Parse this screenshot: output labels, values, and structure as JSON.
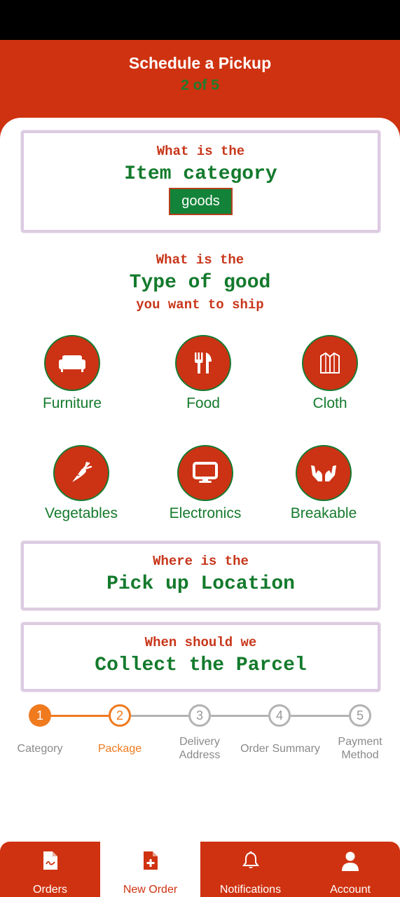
{
  "header": {
    "title": "Schedule a Pickup",
    "step": "2 of 5"
  },
  "category_card": {
    "question": "What is the",
    "heading": "Item category",
    "selected": "goods"
  },
  "good_type": {
    "line1": "What is the",
    "heading": "Type of good",
    "line3": "you want to ship"
  },
  "goods": [
    {
      "label": "Furniture",
      "icon": "sofa-icon"
    },
    {
      "label": "Food",
      "icon": "utensils-icon"
    },
    {
      "label": "Cloth",
      "icon": "shirt-icon"
    },
    {
      "label": "Vegetables",
      "icon": "carrot-icon"
    },
    {
      "label": "Electronics",
      "icon": "monitor-icon"
    },
    {
      "label": "Breakable",
      "icon": "hands-icon"
    }
  ],
  "pickup_card": {
    "question": "Where is the",
    "heading": "Pick up Location"
  },
  "collect_card": {
    "question": "When should we",
    "heading": "Collect the Parcel"
  },
  "stepper": {
    "current": 2,
    "steps": [
      {
        "number": "1",
        "label": "Category",
        "state": "done"
      },
      {
        "number": "2",
        "label": "Package",
        "state": "active"
      },
      {
        "number": "3",
        "label": "Delivery Address",
        "state": "pending"
      },
      {
        "number": "4",
        "label": "Order Summary",
        "state": "pending"
      },
      {
        "number": "5",
        "label": "Payment Method",
        "state": "pending"
      }
    ]
  },
  "bottom_nav": {
    "items": [
      {
        "label": "Orders",
        "icon": "document-icon"
      },
      {
        "label": "New Order",
        "icon": "add-file-icon",
        "active": true
      },
      {
        "label": "Notifications",
        "icon": "bell-icon"
      },
      {
        "label": "Account",
        "icon": "user-icon"
      }
    ]
  },
  "colors": {
    "brand_red": "#cf3210",
    "brand_green": "#137a2c",
    "stepper_orange": "#f07a1e",
    "stepper_gray": "#b3b3b3"
  }
}
